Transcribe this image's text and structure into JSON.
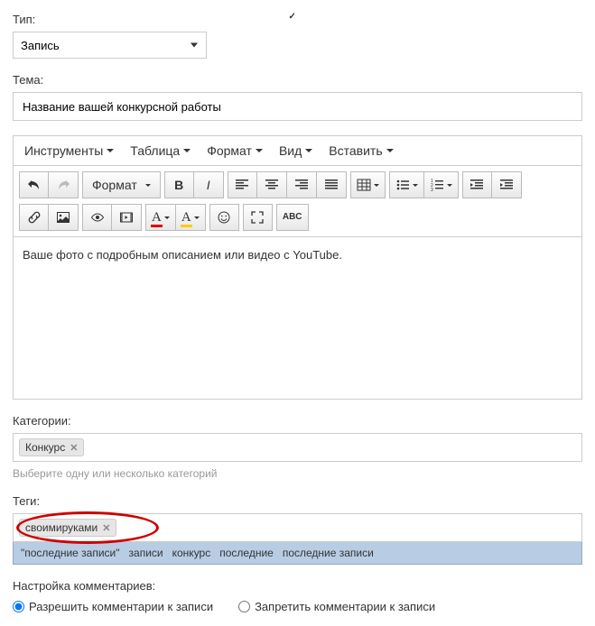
{
  "type": {
    "label": "Тип:",
    "value": "Запись"
  },
  "theme": {
    "label": "Тема:",
    "value": "Название вашей конкурсной работы"
  },
  "editor": {
    "menus": {
      "tools": "Инструменты",
      "table": "Таблица",
      "format": "Формат",
      "view": "Вид",
      "insert": "Вставить"
    },
    "format_btn": "Формат",
    "body_text": "Ваше фото с подробным описанием или видео с YouTube."
  },
  "categories": {
    "label": "Категории:",
    "tags": [
      "Конкурс"
    ],
    "helper": "Выберите одну или несколько категорий"
  },
  "tags": {
    "label": "Теги:",
    "tags": [
      "своимируками"
    ],
    "suggestions": [
      "\"последние записи\"",
      "записи",
      "конкурс",
      "последние",
      "последние записи"
    ]
  },
  "comments": {
    "label": "Настройка комментариев:",
    "allow": "Разрешить комментарии к записи",
    "deny": "Запретить комментарии к записи"
  }
}
